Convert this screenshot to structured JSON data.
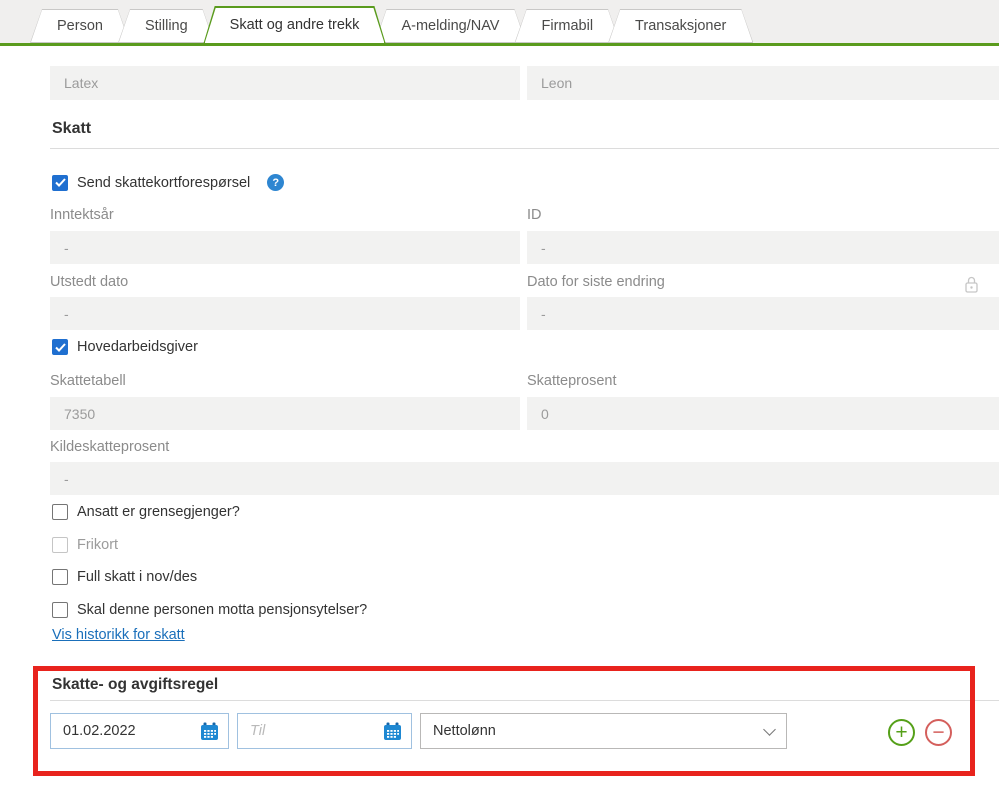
{
  "colors": {
    "accent_green": "#5a9b1d",
    "accent_blue": "#1f6fd0",
    "link_blue": "#1a6fba",
    "annotation_red": "#e8231d",
    "add_green": "#55a019",
    "remove_red": "#d45f5c"
  },
  "tabs": [
    {
      "label": "Person",
      "active": false
    },
    {
      "label": "Stilling",
      "active": false
    },
    {
      "label": "Skatt og andre trekk",
      "active": true
    },
    {
      "label": "A-melding/NAV",
      "active": false
    },
    {
      "label": "Firmabil",
      "active": false
    },
    {
      "label": "Transaksjoner",
      "active": false
    }
  ],
  "name_fields": {
    "first_name": {
      "value": "Latex"
    },
    "last_name": {
      "value": "Leon"
    }
  },
  "skatt": {
    "title": "Skatt",
    "send_request": {
      "label": "Send skattekortforespørsel",
      "checked": true
    },
    "rows": {
      "inntektsar": {
        "label": "Inntektsår",
        "value": "-"
      },
      "id": {
        "label": "ID",
        "value": "-"
      },
      "utstedt_dato": {
        "label": "Utstedt dato",
        "value": "-"
      },
      "dato_siste_endring": {
        "label": "Dato for siste endring",
        "value": "-"
      },
      "skattetabell": {
        "label": "Skattetabell",
        "value": "7350"
      },
      "skatteprosent": {
        "label": "Skatteprosent",
        "value": "0"
      },
      "kildeskatteprosent": {
        "label": "Kildeskatteprosent",
        "value": "-"
      }
    },
    "hovedarbeidsgiver": {
      "label": "Hovedarbeidsgiver",
      "checked": true
    },
    "checkboxes": [
      {
        "label": "Ansatt er grensegjenger?",
        "checked": false,
        "disabled": false
      },
      {
        "label": "Frikort",
        "checked": false,
        "disabled": true
      },
      {
        "label": "Full skatt i nov/des",
        "checked": false,
        "disabled": false
      },
      {
        "label": "Skal denne personen motta pensjonsytelser?",
        "checked": false,
        "disabled": false
      }
    ],
    "history_link": {
      "label": "Vis historikk for skatt"
    }
  },
  "rule_section": {
    "title": "Skatte- og avgiftsregel",
    "from_date": {
      "value": "01.02.2022"
    },
    "to_date": {
      "placeholder": "Til"
    },
    "rule_type": {
      "value": "Nettolønn"
    }
  },
  "icons": {
    "help": "?",
    "add": "+",
    "remove": "−"
  }
}
